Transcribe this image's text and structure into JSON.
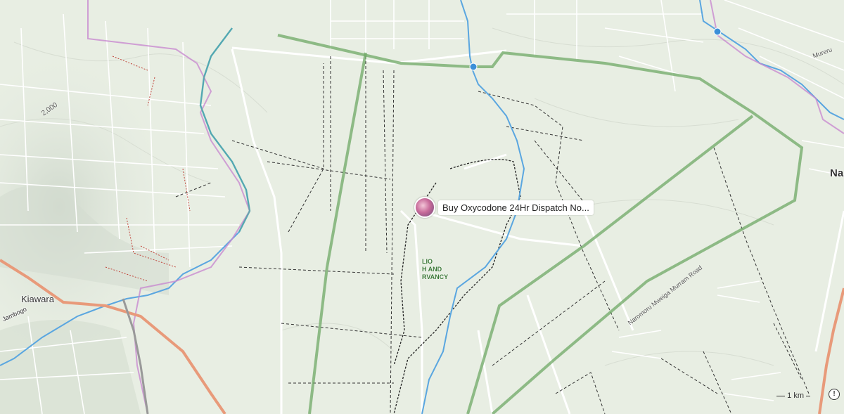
{
  "map": {
    "places": {
      "kiawara": "Kiawara",
      "nanyuki_partial": "Na",
      "jambogo": "Jambogo"
    },
    "contour_label": "2,000",
    "roads": {
      "naromoru": "Naromoru Mweiga Murram Road",
      "mureru": "Mureru"
    },
    "park_label_lines": [
      "LIO",
      "H AND",
      "RVANCY"
    ],
    "marker": {
      "label": "Buy Oxycodone 24Hr Dispatch No..."
    },
    "scale": "1 km",
    "info_icon": "ⓘ"
  },
  "colors": {
    "background": "#e8eee3",
    "boundary_green": "#6fa865",
    "river_blue": "#5aa6e0",
    "major_road": "#e89a7a",
    "admin_purple": "#c889d0"
  }
}
